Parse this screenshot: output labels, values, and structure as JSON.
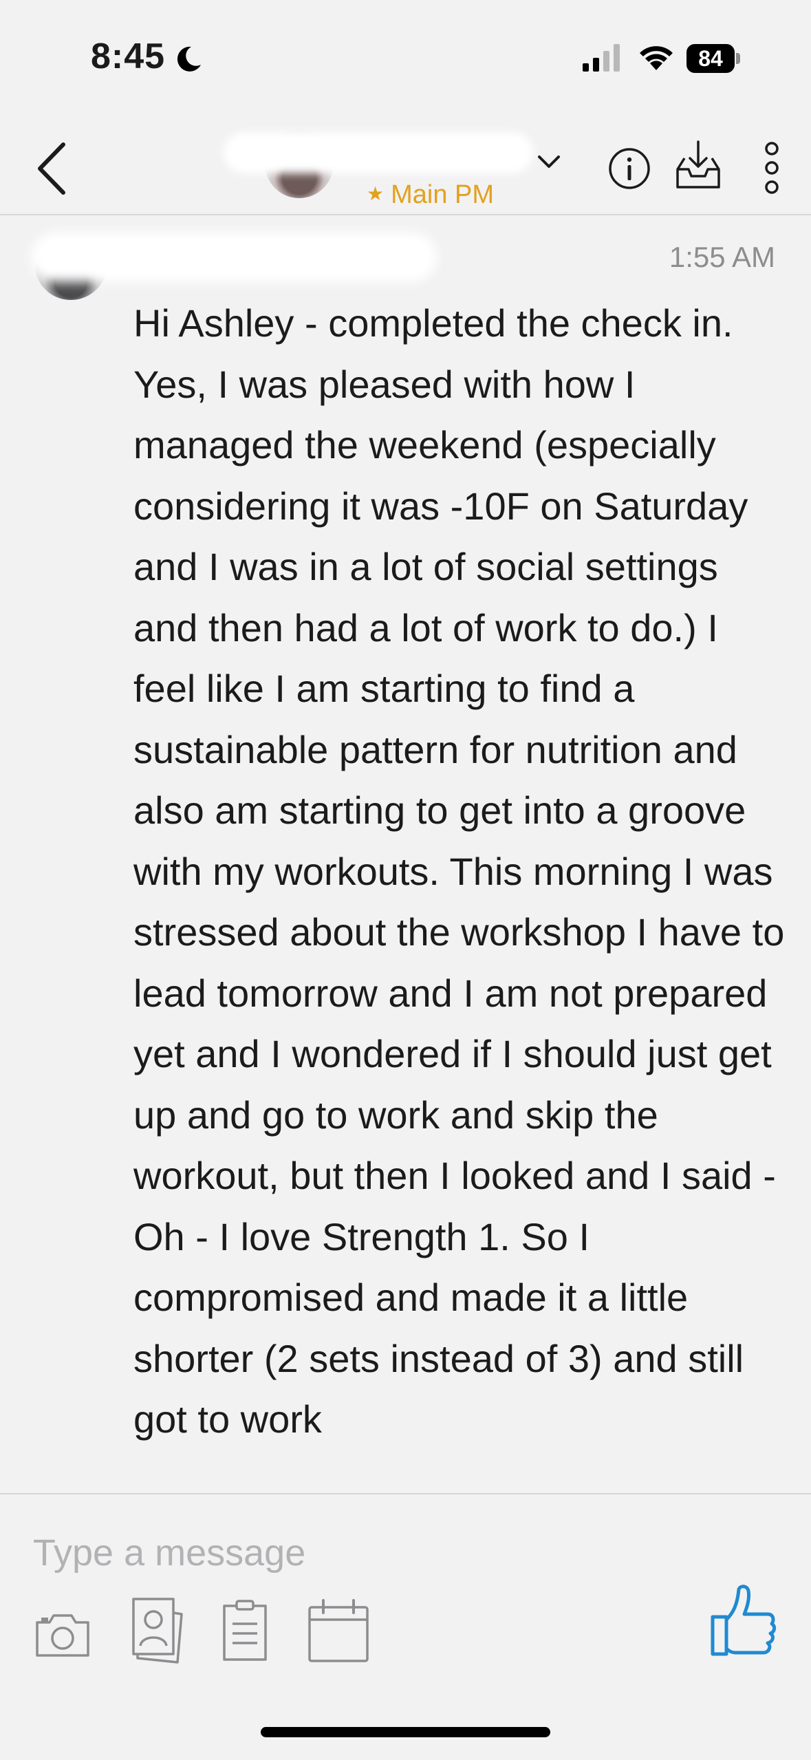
{
  "status_bar": {
    "time": "8:45",
    "battery": "84"
  },
  "header": {
    "subtitle": "Main PM",
    "subtitle_color": "#e2a11e",
    "icons": [
      "back-icon",
      "chevron-down-icon",
      "info-icon",
      "inbox-download-icon",
      "more-vertical-icon"
    ]
  },
  "message": {
    "time": "1:55 AM",
    "text": "Hi Ashley - completed the check in. Yes, I was pleased with how I managed the weekend (especially considering it was -10F on Saturday and I was in a lot of social settings and then had a lot of work to do.) I feel like I am starting to find a sustainable pattern for nutrition and also am starting to get into a groove with my workouts. This morning I was stressed about the workshop I have to lead tomorrow and I am not prepared yet and I wondered if I should just get up and go to work and skip the workout, but then I looked and I said - Oh - I love Strength 1. So I compromised and made it a little shorter (2 sets instead of 3) and still got to work"
  },
  "composer": {
    "placeholder": "Type a message",
    "tools": [
      "camera-icon",
      "contact-card-icon",
      "note-icon",
      "calendar-icon"
    ],
    "send_icon": "thumbs-up-icon",
    "accent_color": "#1f8ad1"
  }
}
